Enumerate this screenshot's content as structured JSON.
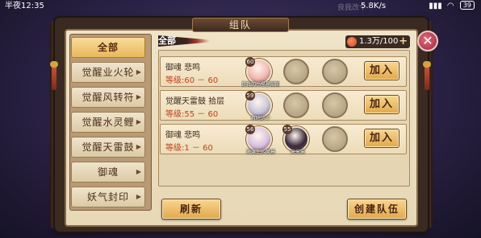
{
  "status_bar": {
    "time": "半夜12:35",
    "network_speed": "5.8K/s",
    "battery": "39",
    "bg_hint_text": "良我改个"
  },
  "window": {
    "title": "组队"
  },
  "header": {
    "filter_label": "全部",
    "coin_amount": "1.3万/100",
    "plus_symbol": "+",
    "close_symbol": "✕"
  },
  "sidebar": {
    "items": [
      {
        "label": "全部",
        "active": true,
        "has_arrow": false
      },
      {
        "label": "觉醒业火轮",
        "active": false,
        "has_arrow": true
      },
      {
        "label": "觉醒风转符",
        "active": false,
        "has_arrow": true
      },
      {
        "label": "觉醒水灵鲤",
        "active": false,
        "has_arrow": true
      },
      {
        "label": "觉醒天雷鼓",
        "active": false,
        "has_arrow": true
      },
      {
        "label": "御魂",
        "active": false,
        "has_arrow": true
      },
      {
        "label": "妖气封印",
        "active": false,
        "has_arrow": true
      }
    ],
    "arrow_symbol": "▶"
  },
  "teams": [
    {
      "title": "御魂 悲鸣",
      "level": "等级:60 － 60",
      "members": [
        {
          "filled": true,
          "lv": "60",
          "name": "是我的小星星阳阳",
          "color": "#f2b6b0"
        },
        {
          "filled": false
        },
        {
          "filled": false
        }
      ],
      "join_label": "加入"
    },
    {
      "title": "觉醒天雷鼓 拾层",
      "level": "等级:55 － 60",
      "members": [
        {
          "filled": true,
          "lv": "59",
          "name": "有啥这个",
          "color": "#c8c4d8"
        },
        {
          "filled": false
        },
        {
          "filled": false
        }
      ],
      "join_label": "加入"
    },
    {
      "title": "御魂 悲鸣",
      "level": "等级:1 － 60",
      "members": [
        {
          "filled": true,
          "lv": "56",
          "name": "海滩上的风景",
          "color": "#d8c0e0"
        },
        {
          "filled": true,
          "lv": "55",
          "name": "米米米",
          "color": "#3a2a3a"
        },
        {
          "filled": false
        }
      ],
      "join_label": "加入"
    }
  ],
  "buttons": {
    "refresh": "刷新",
    "create_team": "创建队伍"
  },
  "colors": {
    "accent_gold": "#e2a84a",
    "level_red": "#c0401e",
    "parchment": "#efe3c8",
    "close_red": "#a0283a"
  }
}
